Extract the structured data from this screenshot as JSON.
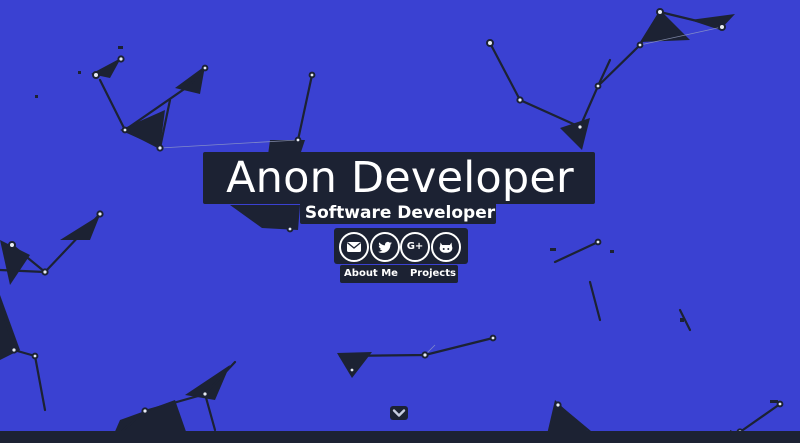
{
  "theme": {
    "background": "#3a41d2",
    "network_color": "#1c2233",
    "node_color": "#e8ecf4",
    "text_color": "#ffffff"
  },
  "hero": {
    "title": "Anon Developer",
    "subtitle": "Software Developer"
  },
  "socials": [
    {
      "name": "Email",
      "icon": "envelope-icon"
    },
    {
      "name": "Twitter",
      "icon": "twitter-bird-icon"
    },
    {
      "name": "Google Plus",
      "icon": "google-plus-icon",
      "glyph": "G+"
    },
    {
      "name": "GitHub",
      "icon": "github-octocat-icon"
    }
  ],
  "nav": {
    "about_label": "About Me",
    "projects_label": "Projects"
  },
  "scroll": {
    "icon": "chevron-down-icon"
  }
}
